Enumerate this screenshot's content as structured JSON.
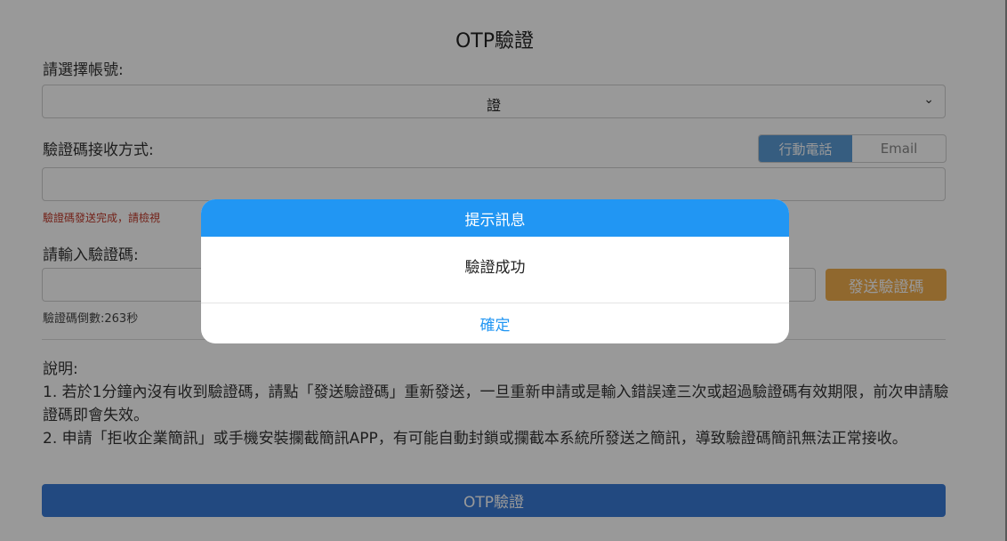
{
  "page": {
    "title": "OTP驗證",
    "account_label": "請選擇帳號:",
    "account_value": "證",
    "method_label": "驗證碼接收方式:",
    "method_options": [
      "行動電話",
      "Email"
    ],
    "notice": "驗證碼發送完成，請檢視",
    "code_label": "請輸入驗證碼:",
    "send_button": "發送驗證碼",
    "countdown": "驗證碼倒數:263秒",
    "desc_title": "說明:",
    "desc_lines": [
      "1. 若於1分鐘內沒有收到驗證碼，請點「發送驗證碼」重新發送，一旦重新申請或是輸入錯誤達三次或超過驗證碼有效期限，前次申請驗證碼即會失效。",
      "2. 申請「拒收企業簡訊」或手機安裝攔截簡訊APP，有可能自動封鎖或攔截本系統所發送之簡訊，導致驗證碼簡訊無法正常接收。"
    ],
    "otp_button": "OTP驗證"
  },
  "modal": {
    "title": "提示訊息",
    "message": "驗證成功",
    "confirm": "確定"
  },
  "colors": {
    "modal_header": "#2196f3",
    "otp_button": "#3a7bd5",
    "send_button": "#f0ad4e",
    "notice": "#c0392b"
  }
}
